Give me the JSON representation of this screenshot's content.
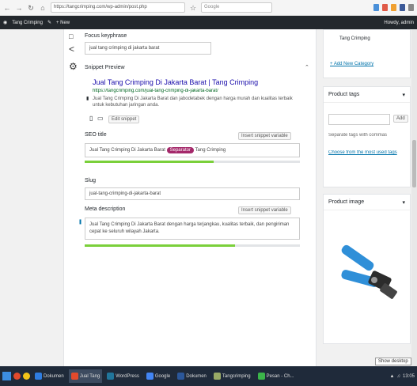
{
  "browser": {
    "url": "https://tangcrimping.com/wp-admin/post.php",
    "search_placeholder": "Google"
  },
  "wp_bar": {
    "site": "Tang Crimping",
    "new": "+ New",
    "user": "Howdy, admin"
  },
  "main": {
    "focus_keyphrase_label": "Focus keyphrase",
    "focus_keyphrase_value": "jual tang crimping di jakarta barat",
    "snippet_preview_label": "Snippet Preview",
    "snippet_title": "Jual Tang Crimping Di Jakarta Barat | Tang Crimping",
    "snippet_url": "https://tangcrimping.com/jual-tang-crimping-di-jakarta-barat/",
    "snippet_desc": "Jual Tang Crimping Di Jakarta Barat dan jabodetabek dengan harga murah dan kualitas terbaik untuk kebutuhan jaringan anda.",
    "edit_snippet_label": "Edit snippet",
    "seo_title_label": "SEO title",
    "seo_title_prefix": "Jual Tang Crimping Di Jakarta Barat",
    "seo_title_chip": "Separator",
    "seo_title_suffix": "Tang Crimping",
    "insert_variable": "Insert snippet variable",
    "slug_label": "Slug",
    "slug_value": "jual-tang-crimping-di-jakarta-barat",
    "meta_desc_label": "Meta description",
    "meta_desc_value": "Jual Tang Crimping Di Jakarta Barat dengan harga terjangkau, kualitas terbaik, dan pengiriman cepat ke seluruh wilayah Jakarta.",
    "seo_title_progress": 0.6,
    "meta_desc_progress": 0.7
  },
  "side": {
    "category_text": "Tang Crimping",
    "add_category": "+ Add New Category",
    "product_tags_label": "Product tags",
    "add_button": "Add",
    "separate_tags": "Separate tags with commas",
    "choose_tags": "Choose from the most used tags",
    "product_image_label": "Product image"
  },
  "taskbar": {
    "items": [
      "Dokumen",
      "Jual Tang",
      "WordPress",
      "Google",
      "Dokumen",
      "Tangcrimping",
      "Pesan - Ch..."
    ],
    "time": "13:05",
    "tooltip": "Show desktop"
  },
  "colors": {
    "wp_bar": "#23282d",
    "link": "#1a0dab",
    "chip": "#a4286a",
    "meter": "#7ad03a",
    "taskbar": "#1f2a3a"
  }
}
